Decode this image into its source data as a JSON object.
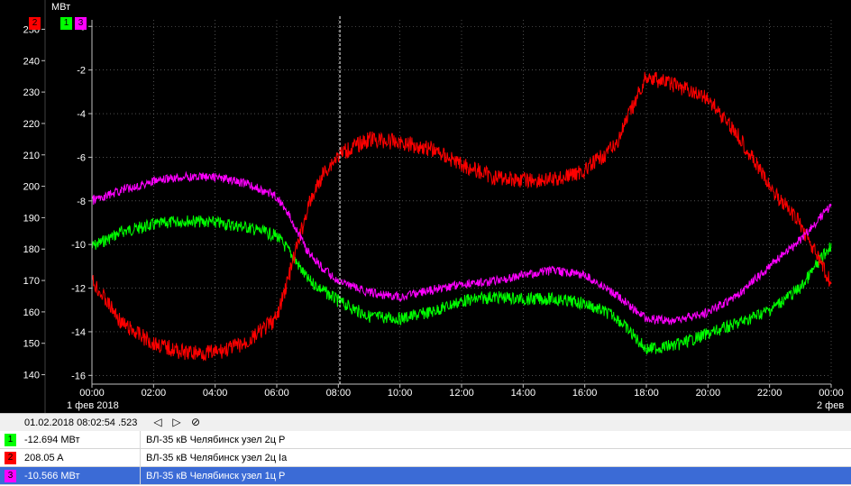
{
  "chart": {
    "unit_label": "МВт",
    "left_axis_badge": "2",
    "right_axis_badges": [
      "1",
      "3"
    ],
    "left_ticks": [
      "250",
      "240",
      "230",
      "220",
      "210",
      "200",
      "190",
      "180",
      "170",
      "160",
      "150",
      "140"
    ],
    "right_ticks": [
      "0",
      "-2",
      "-4",
      "-6",
      "-8",
      "-10",
      "-12",
      "-14",
      "-16"
    ],
    "x_ticks": [
      "00:00",
      "02:00",
      "04:00",
      "06:00",
      "08:00",
      "10:00",
      "12:00",
      "14:00",
      "16:00",
      "18:00",
      "20:00",
      "22:00",
      "00:00"
    ],
    "x_date_start": "1 фев 2018",
    "x_date_end": "2 фев",
    "colors": {
      "s1": "#00ff00",
      "s2": "#ff0000",
      "s3": "#ff00ff",
      "background": "#000000",
      "grid": "#808080"
    }
  },
  "chart_data": {
    "type": "line",
    "x_unit": "hours",
    "x": [
      0,
      1,
      2,
      3,
      4,
      5,
      6,
      6.5,
      7,
      7.5,
      8,
      9,
      10,
      11,
      12,
      13,
      14,
      15,
      16,
      17,
      18,
      19,
      20,
      21,
      22,
      23,
      24
    ],
    "xlim": [
      0,
      24
    ],
    "cursor_x": 8.05,
    "left_axis": {
      "ylim": [
        137,
        253
      ]
    },
    "right_axis": {
      "ylim": [
        -16.4,
        0.3
      ]
    },
    "series": [
      {
        "id": "1",
        "axis": "right",
        "color": "#00ff00",
        "values": [
          -10.1,
          -9.4,
          -9.1,
          -8.9,
          -9.0,
          -9.2,
          -9.6,
          -10.5,
          -11.6,
          -12.1,
          -12.6,
          -13.3,
          -13.4,
          -13.1,
          -12.6,
          -12.4,
          -12.5,
          -12.5,
          -12.7,
          -13.3,
          -14.8,
          -14.6,
          -14.1,
          -13.6,
          -13.0,
          -12.0,
          -10.0
        ]
      },
      {
        "id": "2",
        "axis": "left",
        "color": "#ff0000",
        "values": [
          170,
          156,
          150,
          147,
          147,
          150,
          158,
          175,
          193,
          204,
          210,
          215,
          214,
          212,
          207,
          203,
          202,
          202,
          205,
          213,
          235,
          232,
          228,
          216,
          200,
          188,
          169
        ]
      },
      {
        "id": "3",
        "axis": "right",
        "color": "#ff00ff",
        "values": [
          -8.0,
          -7.5,
          -7.1,
          -6.9,
          -6.9,
          -7.2,
          -7.8,
          -8.9,
          -10.3,
          -11.1,
          -11.7,
          -12.2,
          -12.4,
          -12.1,
          -11.8,
          -11.7,
          -11.4,
          -11.2,
          -11.4,
          -12.3,
          -13.4,
          -13.5,
          -13.1,
          -12.3,
          -11.0,
          -9.8,
          -8.2
        ]
      }
    ]
  },
  "status": {
    "cursor_time": "01.02.2018 08:02:54 .523",
    "prev_icon": "◁",
    "next_icon": "▷",
    "clear_icon": "⊘"
  },
  "legend": [
    {
      "num": "1",
      "value": "-12.694 МВт",
      "name": "ВЛ-35 кВ Челябинск узел 2ц P",
      "color": "#00ff00"
    },
    {
      "num": "2",
      "value": "208.05 A",
      "name": "ВЛ-35 кВ Челябинск узел 2ц Ia",
      "color": "#ff0000"
    },
    {
      "num": "3",
      "value": "-10.566 МВт",
      "name": "ВЛ-35 кВ Челябинск узел 1ц P",
      "color": "#ff00ff"
    }
  ]
}
